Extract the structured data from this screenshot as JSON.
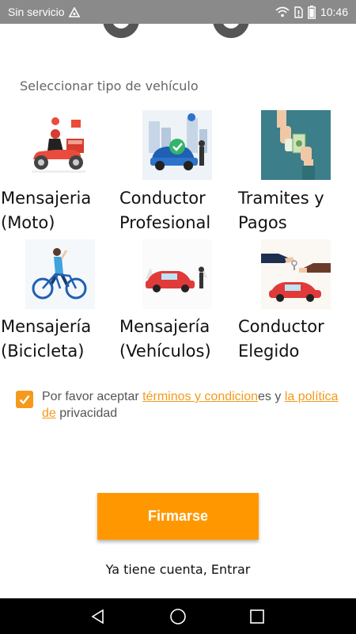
{
  "status_bar": {
    "carrier": "Sin servicio",
    "time": "10:46",
    "icons": [
      "sync-icon",
      "wifi-icon",
      "sim-icon",
      "battery-icon"
    ]
  },
  "form": {
    "section_label": "Seleccionar tipo de vehículo",
    "vehicle_types": [
      {
        "label": "Mensajeria\n(Moto)",
        "icon": "motorcycle-courier-icon"
      },
      {
        "label": "Conductor\nProfesional",
        "icon": "professional-driver-icon"
      },
      {
        "label": "Tramites y\nPagos",
        "icon": "payments-icon"
      },
      {
        "label": "Mensajería\n(Bicicleta)",
        "icon": "bicycle-courier-icon"
      },
      {
        "label": "Mensajería\n(Vehículos)",
        "icon": "car-courier-icon"
      },
      {
        "label": "Conductor\nElegido",
        "icon": "designated-driver-icon"
      }
    ],
    "terms": {
      "checked": true,
      "prefix": "Por favor aceptar ",
      "terms_link": "términos y condicion",
      "middle": "es y ",
      "privacy_link": "la política de",
      "suffix": " privacidad"
    },
    "submit_label": "Firmarse",
    "login_label": "Ya tiene cuenta, Entrar"
  },
  "colors": {
    "accent": "#ff9800",
    "status_bar": "#8a8a8a",
    "nav_bar": "#000000"
  },
  "nav_bar": {
    "buttons": [
      "back-icon",
      "home-icon",
      "recents-icon"
    ]
  }
}
